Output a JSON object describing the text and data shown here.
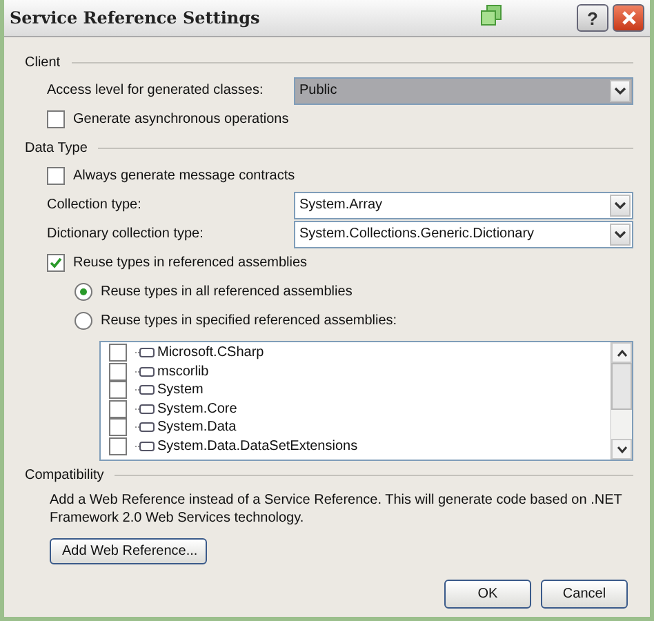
{
  "window": {
    "title": "Service Reference Settings",
    "help": "?"
  },
  "client": {
    "heading": "Client",
    "access_level": {
      "label": "Access level for generated classes:",
      "value": "Public",
      "focused": true
    },
    "async": {
      "label": "Generate asynchronous operations",
      "checked": false
    }
  },
  "data_type": {
    "heading": "Data Type",
    "message_contracts": {
      "label": "Always generate message contracts",
      "checked": false
    },
    "collection_type": {
      "label": "Collection type:",
      "value": "System.Array",
      "focused": false
    },
    "dictionary_type": {
      "label": "Dictionary collection type:",
      "value": "System.Collections.Generic.Dictionary",
      "focused": false
    },
    "reuse_types": {
      "label": "Reuse types in referenced assemblies",
      "checked": true
    },
    "reuse_options": [
      {
        "label": "Reuse types in all referenced assemblies",
        "selected": true
      },
      {
        "label": "Reuse types in specified referenced assemblies:",
        "selected": false
      }
    ],
    "assemblies": [
      {
        "name": "Microsoft.CSharp",
        "checked": false
      },
      {
        "name": "mscorlib",
        "checked": false
      },
      {
        "name": "System",
        "checked": false
      },
      {
        "name": "System.Core",
        "checked": false
      },
      {
        "name": "System.Data",
        "checked": false
      },
      {
        "name": "System.Data.DataSetExtensions",
        "checked": false
      }
    ]
  },
  "compatibility": {
    "heading": "Compatibility",
    "text": "Add a Web Reference instead of a Service Reference. This will generate code based on .NET Framework 2.0 Web Services technology.",
    "button": "Add Web Reference..."
  },
  "buttons": [
    {
      "label": "OK"
    },
    {
      "label": "Cancel"
    }
  ]
}
